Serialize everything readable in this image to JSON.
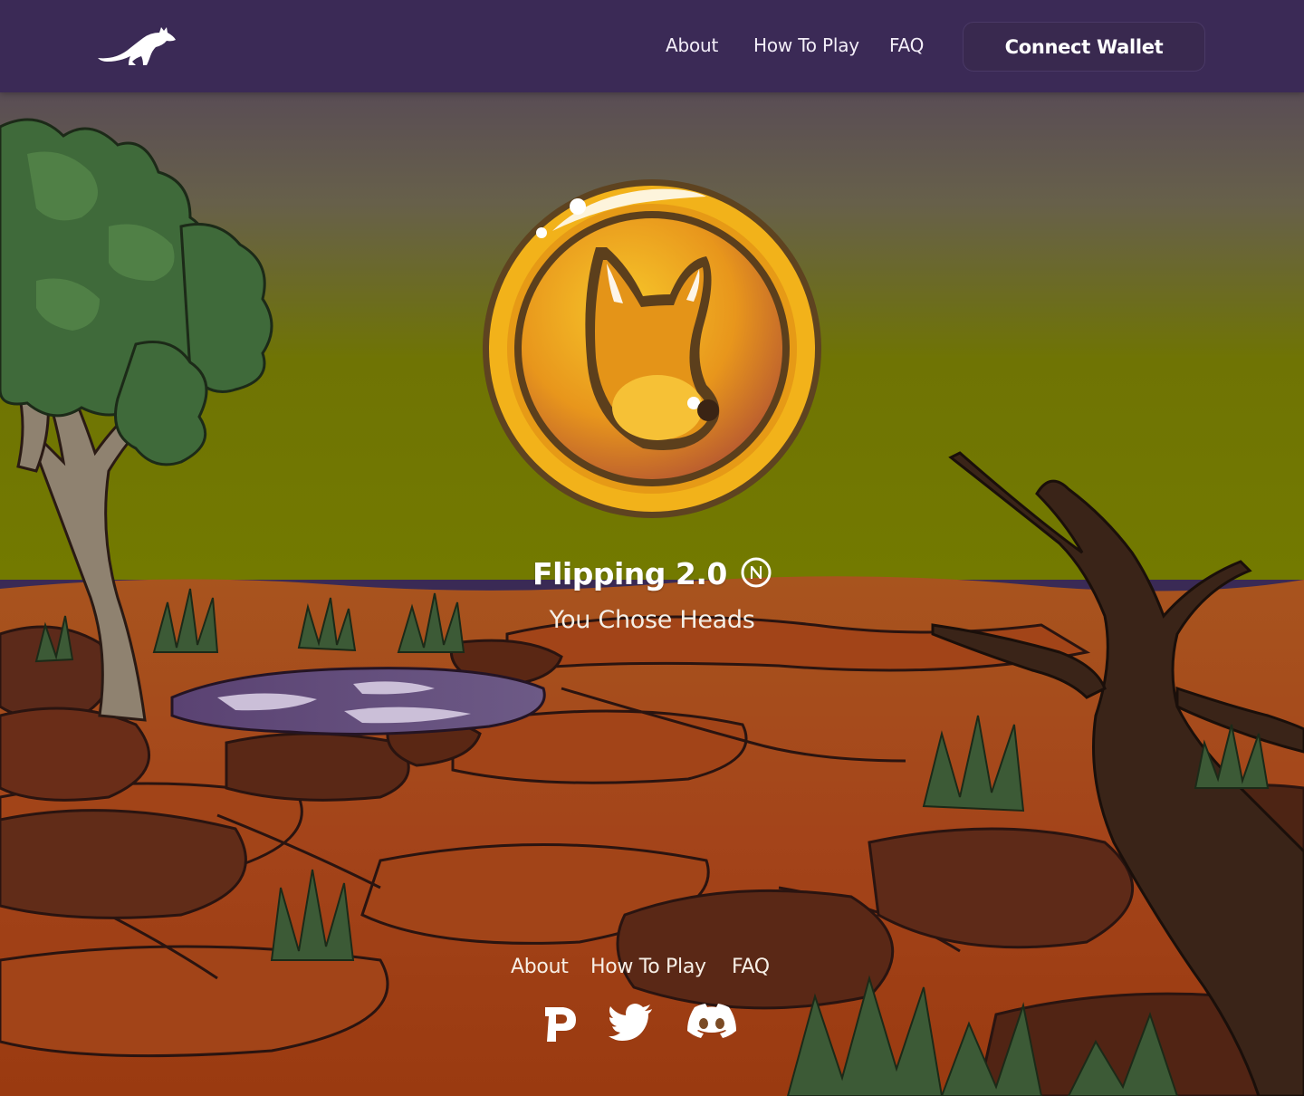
{
  "nav": {
    "logo_icon": "kangaroo-logo-icon",
    "links": [
      "About",
      "How To Play",
      "FAQ"
    ],
    "connect_label": "Connect Wallet"
  },
  "hero": {
    "coin_icon": "kangaroo-coin-icon",
    "title": "Flipping 2.0",
    "currency_icon": "near-icon",
    "subtitle": "You Chose Heads"
  },
  "footer": {
    "links": [
      "About",
      "How To Play",
      "FAQ"
    ],
    "social_icons": [
      "paras-icon",
      "twitter-icon",
      "discord-icon"
    ]
  },
  "colors": {
    "navbar": "#3b2a56",
    "sky_top": "#4f3d5e",
    "sky_bottom": "#6e7400",
    "ground": "#a8421a",
    "coin_gold": "#f2b41c",
    "text": "#ffffff"
  }
}
